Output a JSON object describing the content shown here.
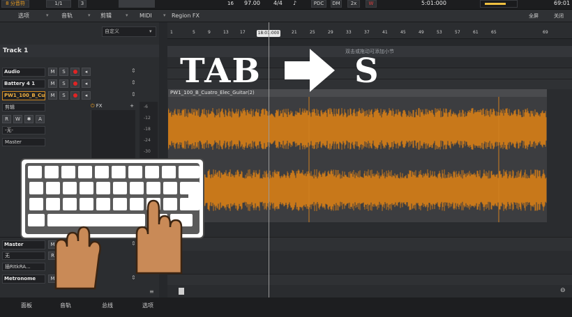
{
  "transport": {
    "left_box": "8 分音符",
    "frac": "1/1",
    "three": "3",
    "sixteen": "16",
    "tempo": "97.00",
    "sig": "4/4",
    "pdc": "PDC",
    "dm": "DM",
    "twox": "2x",
    "time": "5:01:000",
    "right_num": "69:01"
  },
  "menu": {
    "items": [
      "选项",
      "音轨",
      "剪辑",
      "MIDI",
      "Region FX"
    ],
    "right1": "全屏",
    "right2": "关闭"
  },
  "left": {
    "preset": "自定义",
    "track_title": "Track 1",
    "audio_label": "Audio",
    "battery_label": "Battery 4 1",
    "clip_label": "PW1_100_B_Cu",
    "edit_label": "剪辑",
    "fx_label": "FX",
    "none_label": "-无-",
    "master_label": "Master",
    "master_track": "Master",
    "none2": "无",
    "hook": "插RItkRA...",
    "metronome": "Metronome",
    "m_letter": "M",
    "s_letter": "S",
    "r_letter": "R",
    "w_letter": "W",
    "star_letter": "✱",
    "a_letter": "A"
  },
  "ruler": {
    "numbers": [
      "1",
      "5",
      "9",
      "13",
      "17",
      "21",
      "25",
      "29",
      "33",
      "37",
      "41",
      "45",
      "49",
      "53",
      "57",
      "61",
      "65",
      "69"
    ],
    "position": "18:01:000"
  },
  "arranger": {
    "hint": "双击或拖动可添加小节",
    "clip_name": "PW1_100_B_Cuatro_Elec_Guitar(2)"
  },
  "meter_ticks": [
    "-6",
    "-12",
    "-18",
    "-24",
    "-30"
  ],
  "overlay": {
    "tab": "TAB",
    "key": "S"
  },
  "bottom": {
    "tabs": [
      "面板",
      "音轨",
      "总线",
      "选项"
    ]
  },
  "colors": {
    "waveform": "#c8781a",
    "background": "#26282b",
    "highlight": "#d28a20",
    "record": "#e02424"
  }
}
